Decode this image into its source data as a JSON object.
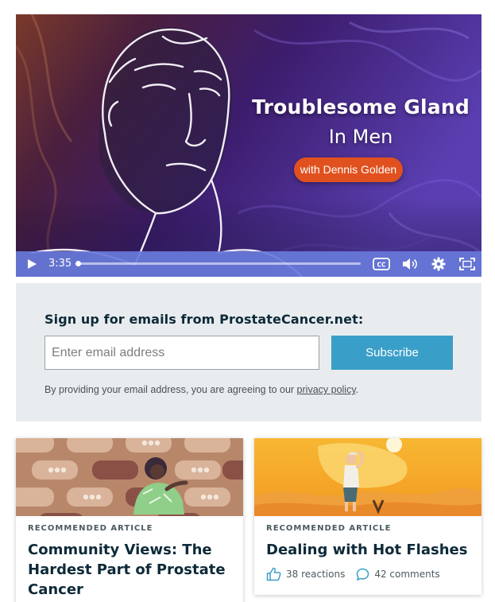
{
  "video": {
    "title_line1": "Troublesome Gland",
    "title_line2": "In Men",
    "presenter": "with Dennis Golden",
    "time": "3:35",
    "progress": 0.0,
    "controls": {
      "play": "play-icon",
      "captions": "closed-captions-icon",
      "volume": "volume-icon",
      "settings": "gear-icon",
      "fullscreen": "fullscreen-icon"
    },
    "colors": {
      "pill": "#e0511f",
      "control_bar": "#687ada"
    }
  },
  "signup": {
    "heading": "Sign up for emails from ProstateCancer.net:",
    "email_placeholder": "Enter email address",
    "email_value": "",
    "subscribe_label": "Subscribe",
    "note_prefix": "By providing your email address, you are agreeing to our ",
    "privacy_link": "privacy policy",
    "note_suffix": ".",
    "colors": {
      "button": "#3a9fc8",
      "panel": "#e8ecef"
    }
  },
  "cards": [
    {
      "kicker": "RECOMMENDED ARTICLE",
      "title": "Community Views: The Hardest Part of Prostate Cancer"
    },
    {
      "kicker": "RECOMMENDED ARTICLE",
      "title": "Dealing with Hot Flashes",
      "reactions": "38 reactions",
      "comments": "42 comments"
    }
  ]
}
